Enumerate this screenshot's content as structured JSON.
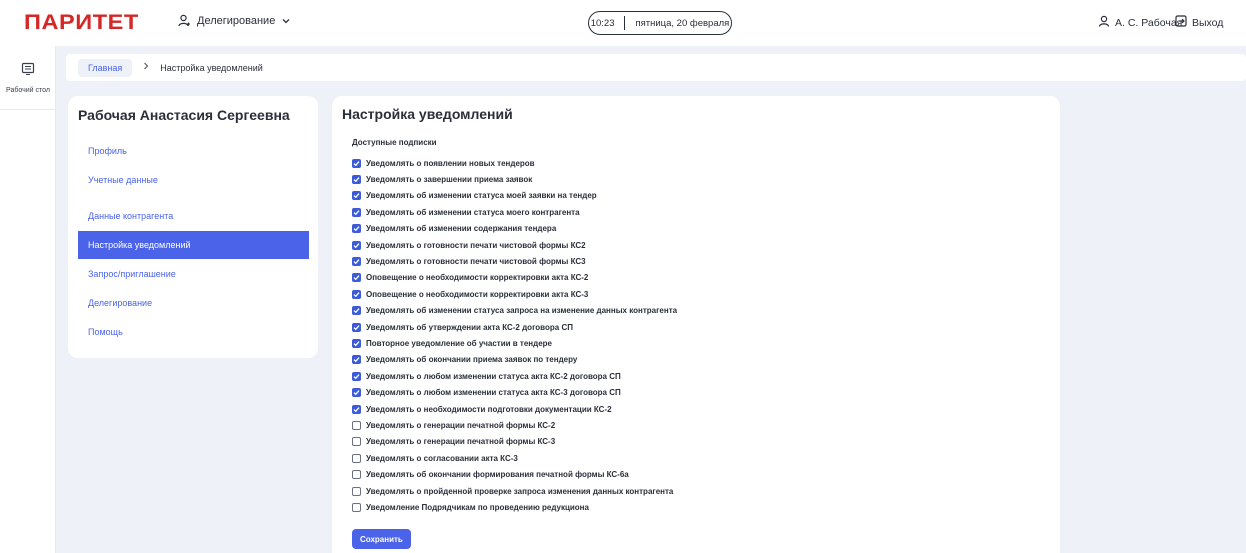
{
  "header": {
    "logo": "ПАРИТЕТ",
    "delegation_menu": "Делегирование",
    "time": "10:23",
    "date": "пятница, 20 февраля",
    "user": "А. С. Рабочая",
    "logout": "Выход"
  },
  "rail": {
    "items": [
      {
        "label": "Рабочий стол"
      }
    ]
  },
  "breadcrumb": {
    "home": "Главная",
    "current": "Настройка уведомлений"
  },
  "side_menu": {
    "title": "Рабочая Анастасия Сергеевна",
    "items": [
      {
        "label": "Профиль",
        "active": false
      },
      {
        "label": "Учетные данные",
        "active": false
      },
      {
        "label": "Данные контрагента",
        "active": false
      },
      {
        "label": "Настройка уведомлений",
        "active": true
      },
      {
        "label": "Запрос/приглашение",
        "active": false
      },
      {
        "label": "Делегирование",
        "active": false
      },
      {
        "label": "Помощь",
        "active": false
      }
    ]
  },
  "content": {
    "title": "Настройка уведомлений",
    "subscriptions_label": "Доступные подписки",
    "subscriptions": [
      {
        "label": "Уведомлять о появлении новых тендеров",
        "checked": true
      },
      {
        "label": "Уведомлять о завершении приема заявок",
        "checked": true
      },
      {
        "label": "Уведомлять об изменении статуса моей заявки на тендер",
        "checked": true
      },
      {
        "label": "Уведомлять об изменении статуса моего контрагента",
        "checked": true
      },
      {
        "label": "Уведомлять об изменении содержания тендера",
        "checked": true
      },
      {
        "label": "Уведомлять о готовности печати чистовой формы КС2",
        "checked": true
      },
      {
        "label": "Уведомлять о готовности печати чистовой формы КС3",
        "checked": true
      },
      {
        "label": "Оповещение о необходимости корректировки акта КС-2",
        "checked": true
      },
      {
        "label": "Оповещение о необходимости корректировки акта КС-3",
        "checked": true
      },
      {
        "label": "Уведомлять об изменении статуса запроса на изменение данных контрагента",
        "checked": true
      },
      {
        "label": "Уведомлять об утверждении акта КС-2 договора СП",
        "checked": true
      },
      {
        "label": "Повторное уведомление об участии в тендере",
        "checked": true
      },
      {
        "label": "Уведомлять об окончании приема заявок по тендеру",
        "checked": true
      },
      {
        "label": "Уведомлять о любом изменении статуса акта КС-2 договора СП",
        "checked": true
      },
      {
        "label": "Уведомлять о любом изменении статуса акта КС-3 договора СП",
        "checked": true
      },
      {
        "label": "Уведомлять о необходимости подготовки документации КС-2",
        "checked": true
      },
      {
        "label": "Уведомлять о генерации печатной формы КС-2",
        "checked": false
      },
      {
        "label": "Уведомлять о генерации печатной формы КС-3",
        "checked": false
      },
      {
        "label": "Уведомлять о согласовании акта КС-3",
        "checked": false
      },
      {
        "label": "Уведомлять об окончании формирования печатной формы КС-6а",
        "checked": false
      },
      {
        "label": "Уведомлять о пройденной проверке запроса изменения данных контрагента",
        "checked": false
      },
      {
        "label": "Уведомление Подрядчикам по проведению редукциона",
        "checked": false
      }
    ],
    "save_label": "Сохранить"
  },
  "colors": {
    "brand": "#d62626",
    "accent": "#4a63e8",
    "background": "#eef1f7"
  }
}
